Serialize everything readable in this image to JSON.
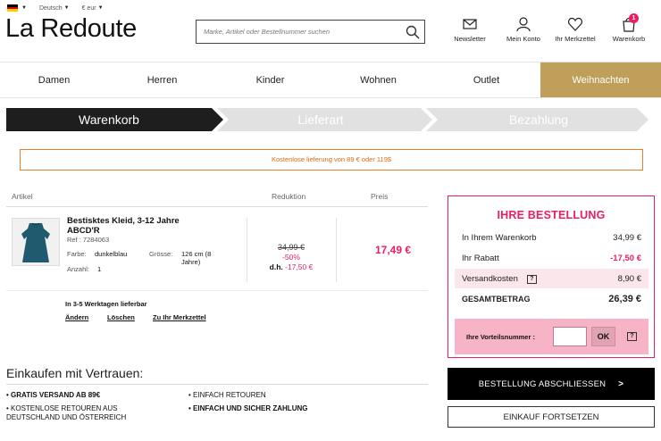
{
  "topbar": {
    "language": "Deutsch",
    "currency": "€ eur",
    "flag_colors": [
      "#000000",
      "#dd0000",
      "#ffce00"
    ]
  },
  "header": {
    "logo": "La Redoute",
    "search_placeholder": "Marke, Artikel oder Bestellnummer suchen",
    "icons": {
      "newsletter": "Newsletter",
      "account": "Mein Konto",
      "wishlist": "Ihr Merkzettel",
      "cart": "Warenkorb",
      "cart_count": "1"
    }
  },
  "nav": {
    "items": [
      "Damen",
      "Herren",
      "Kinder",
      "Wohnen",
      "Outlet",
      "Weihnachten"
    ]
  },
  "steps": [
    "Warenkorb",
    "Lieferart",
    "Bezahlung"
  ],
  "promo": "Kostenlose lieferung von 89 € oder 119$",
  "cart": {
    "headers": {
      "article": "Artikel",
      "reduction": "Reduktion",
      "price": "Preis"
    },
    "item": {
      "name_line1": "Bestisktes Kleid, 3-12 Jahre",
      "name_line2": "ABCD'R",
      "ref_label": "Ref : 7284063",
      "color_label": "Farbe:",
      "color_value": "dunkelblau",
      "size_label": "Grösse:",
      "size_value_1": "126 cm (8",
      "size_value_2": "Jahre)",
      "qty_label": "Anzahl:",
      "qty_value": "1",
      "old_price": "34,99 €",
      "percent": "-50%",
      "dh_label": "d.h.",
      "dh_value": "-17,50 €",
      "price": "17,49 €"
    },
    "delivery": "In 3-5 Werktagen lieferbar",
    "actions": {
      "change": "Ändern",
      "delete": "Löschen",
      "wishlist": "Zu Ihr Merkzettel"
    }
  },
  "trust": {
    "title": "Einkaufen mit Vertrauen:",
    "items": {
      "free_shipping": "• GRATIS VERSAND AB 89€",
      "free_returns_1": "• KOSTENLOSE RETOUREN AUS",
      "free_returns_2": "DEUTSCHLAND UND ÖSTERREICH",
      "easy_returns": "• EINFACH RETOUREN",
      "safe_payment": "• EINFACH UND SICHER ZAHLUNG"
    }
  },
  "summary": {
    "title": "IHRE BESTELLUNG",
    "rows": {
      "cart_label": "In Ihrem Warenkorb",
      "cart_value": "34,99 €",
      "discount_label": "Ihr Rabatt",
      "discount_value": "-17,50 €",
      "shipping_label": "Versandkosten",
      "shipping_value": "8,90 €",
      "total_label": "GESAMTBETRAG",
      "total_value": "26,39 €"
    },
    "help": "?",
    "voucher_label": "Ihre Vorteilsnummer :",
    "ok": "OK"
  },
  "buttons": {
    "order": "BESTELLUNG ABSCHLIESSEN",
    "order_arrow": ">",
    "continue": "EINKAUF FORTSETZEN"
  },
  "colors": {
    "accent_pink": "#e91e63",
    "gold": "#bf9f5a",
    "promo_orange": "#e87d2a",
    "voucher_bg": "#f6b4c6"
  }
}
